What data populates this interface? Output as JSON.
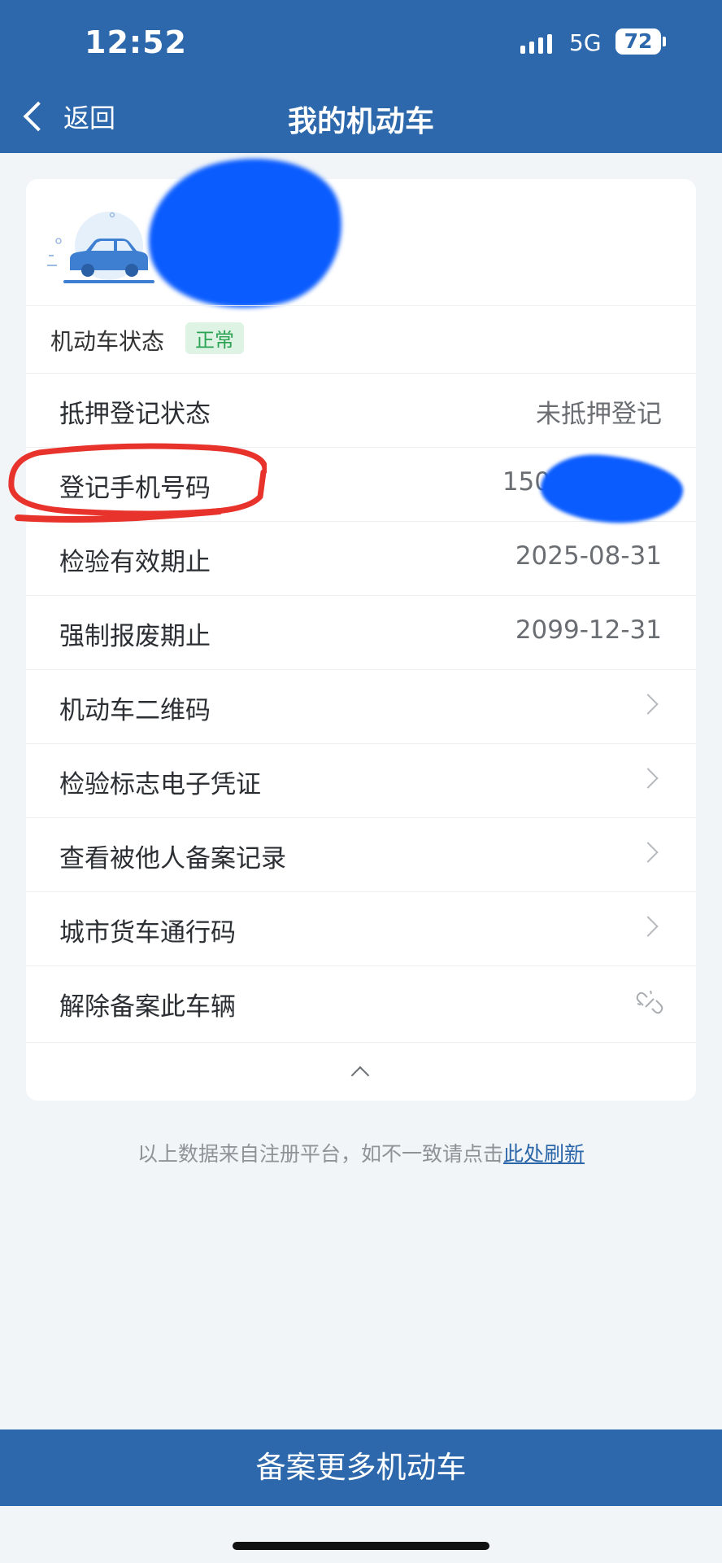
{
  "status_bar": {
    "time": "12:52",
    "network": "5G",
    "battery": "72"
  },
  "nav": {
    "back_label": "返回",
    "title": "我的机动车"
  },
  "vehicle": {
    "status_label": "机动车状态",
    "status_value": "正常"
  },
  "rows": [
    {
      "label": "抵押登记状态",
      "value": "未抵押登记"
    },
    {
      "label": "登记手机号码",
      "value": "150**"
    },
    {
      "label": "检验有效期止",
      "value": "2025-08-31"
    },
    {
      "label": "强制报废期止",
      "value": "2099-12-31"
    },
    {
      "label": "机动车二维码"
    },
    {
      "label": "检验标志电子凭证"
    },
    {
      "label": "查看被他人备案记录"
    },
    {
      "label": "城市货车通行码"
    },
    {
      "label": "解除备案此车辆"
    }
  ],
  "footnote": {
    "text": "以上数据来自注册平台，如不一致请点击",
    "link": "此处刷新"
  },
  "bottom_button": "备案更多机动车",
  "icons": {
    "back": "chevron-left-icon",
    "car": "car-icon",
    "row_arrow": "chevron-right-icon",
    "unlink": "unlink-icon",
    "collapse": "chevron-up-icon"
  },
  "colors": {
    "brand": "#2c68ab",
    "badge_green": "#29a352",
    "annotation": "#e8332c",
    "redaction": "#0a5cff"
  }
}
